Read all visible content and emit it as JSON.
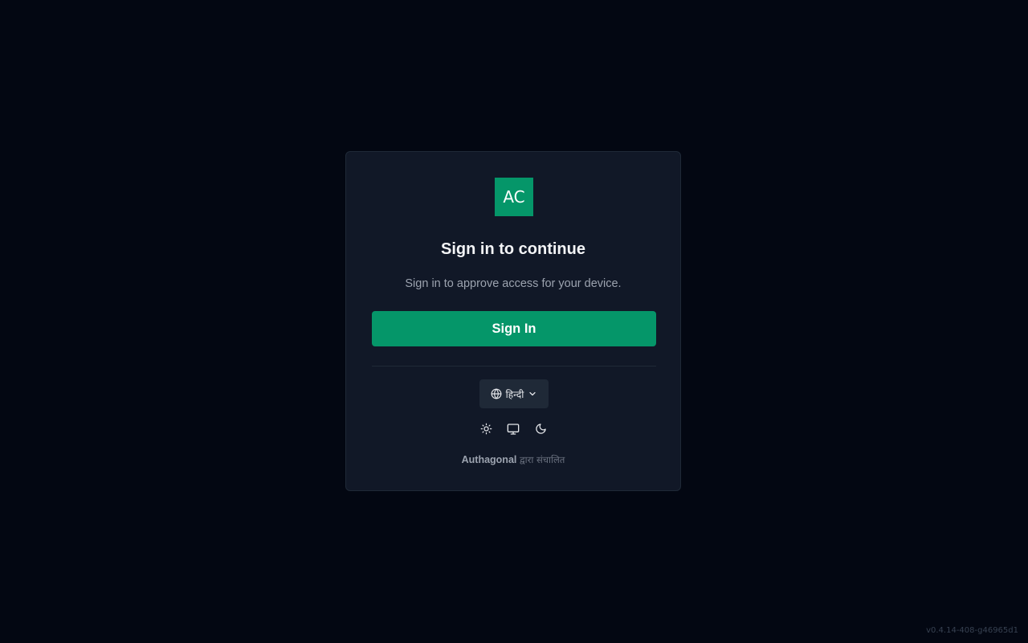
{
  "colors": {
    "background": "#030712",
    "card": "#111827",
    "accent": "#059669",
    "logo_bg": "#059669"
  },
  "logo": {
    "text": "AC"
  },
  "title": "Sign in to continue",
  "subtitle": "Sign in to approve access for your device.",
  "signin_button": {
    "label": "Sign In"
  },
  "language": {
    "selected": "हिन्दी",
    "icon": "globe-icon"
  },
  "theme": {
    "options": [
      {
        "name": "light",
        "icon": "sun-icon"
      },
      {
        "name": "system",
        "icon": "monitor-icon"
      },
      {
        "name": "dark",
        "icon": "moon-icon"
      }
    ]
  },
  "footer": {
    "brand": "Authagonal",
    "suffix": " द्वारा संचालित"
  },
  "version": "v0.4.14-408-g46965d1"
}
